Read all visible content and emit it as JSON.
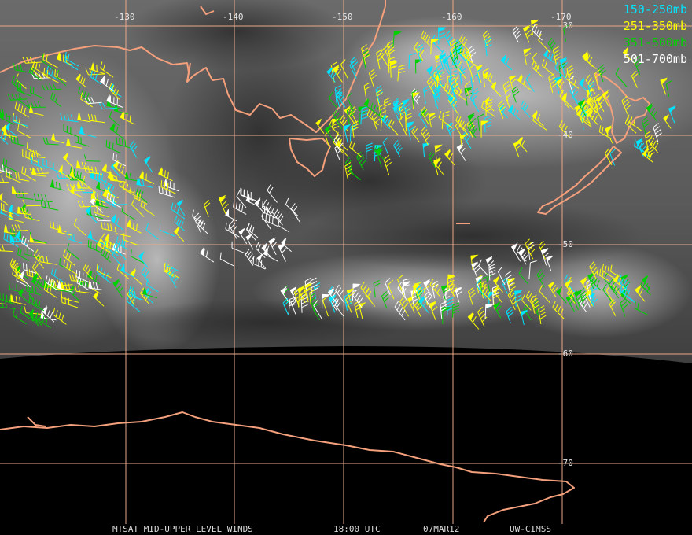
{
  "title": {
    "product": "MTSAT MID-UPPER LEVEL WINDS",
    "time": "18:00 UTC",
    "date": "07MAR12",
    "source": "UW-CIMSS"
  },
  "legend": [
    {
      "label": "150-250mb",
      "color": "#00e5ff"
    },
    {
      "label": "251-350mb",
      "color": "#ffff00"
    },
    {
      "label": "351-500mb",
      "color": "#00d000"
    },
    {
      "label": "501-700mb",
      "color": "#ffffff"
    }
  ],
  "longitude_labels": [
    "-130",
    "-140",
    "-150",
    "-160",
    "-170"
  ],
  "latitude_labels": [
    "-30",
    "-40",
    "-50",
    "-60",
    "-70"
  ],
  "colors": {
    "coastline": "#f4a07c",
    "grid": "#e9a888",
    "earth_edge_black": "#000000"
  }
}
